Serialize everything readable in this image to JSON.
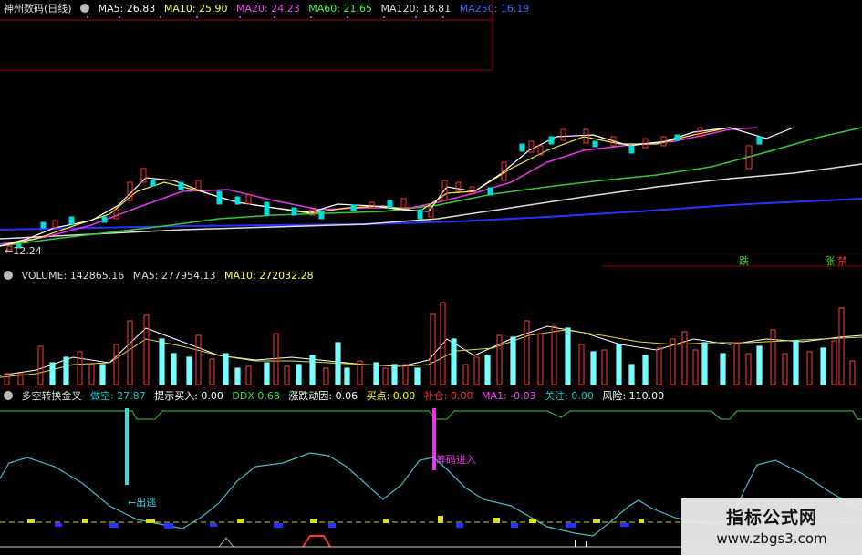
{
  "price_panel": {
    "title": "神州数码(日线)",
    "ma": [
      {
        "label": "MA5: 26.83",
        "color": "#ffffff"
      },
      {
        "label": "MA10: 25.90",
        "color": "#ffff55"
      },
      {
        "label": "MA20: 24.23",
        "color": "#ff44ff"
      },
      {
        "label": "MA60: 21.65",
        "color": "#44ff44"
      },
      {
        "label": "MA120: 18.81",
        "color": "#dddddd"
      },
      {
        "label": "MA250: 16.19",
        "color": "#4466ff"
      }
    ],
    "low_marker": "12.24"
  },
  "signal_labels": {
    "down": "跌",
    "rise": "涨",
    "flag": "禁"
  },
  "volume_panel": {
    "label": "VOLUME: 142865.16",
    "ma5": "MA5: 277954.13",
    "ma10": "MA10: 272032.28"
  },
  "indicator_panel": {
    "title": "多空转换金叉",
    "items": [
      {
        "label": "做空: 27.87",
        "color": "#00cccc"
      },
      {
        "label": "提示买入: 0.00",
        "color": "#ffffff"
      },
      {
        "label": "DDX 0.68",
        "color": "#44dd44"
      },
      {
        "label": "涨跌动因: 0.06",
        "color": "#ffffff"
      },
      {
        "label": "买点: 0.00",
        "color": "#ffff00"
      },
      {
        "label": "补仓: 0.00",
        "color": "#ff3333"
      },
      {
        "label": "MA1: -0.03",
        "color": "#ff44ff"
      },
      {
        "label": "关注: 0.00",
        "color": "#00cccc"
      },
      {
        "label": "风险: 110.00",
        "color": "#ffffff"
      }
    ],
    "exit_label": "←出逃",
    "entry_label": "筹码进入"
  },
  "watermark": {
    "line1": "指标公式网",
    "line2": "www.zbgs3.com"
  }
}
